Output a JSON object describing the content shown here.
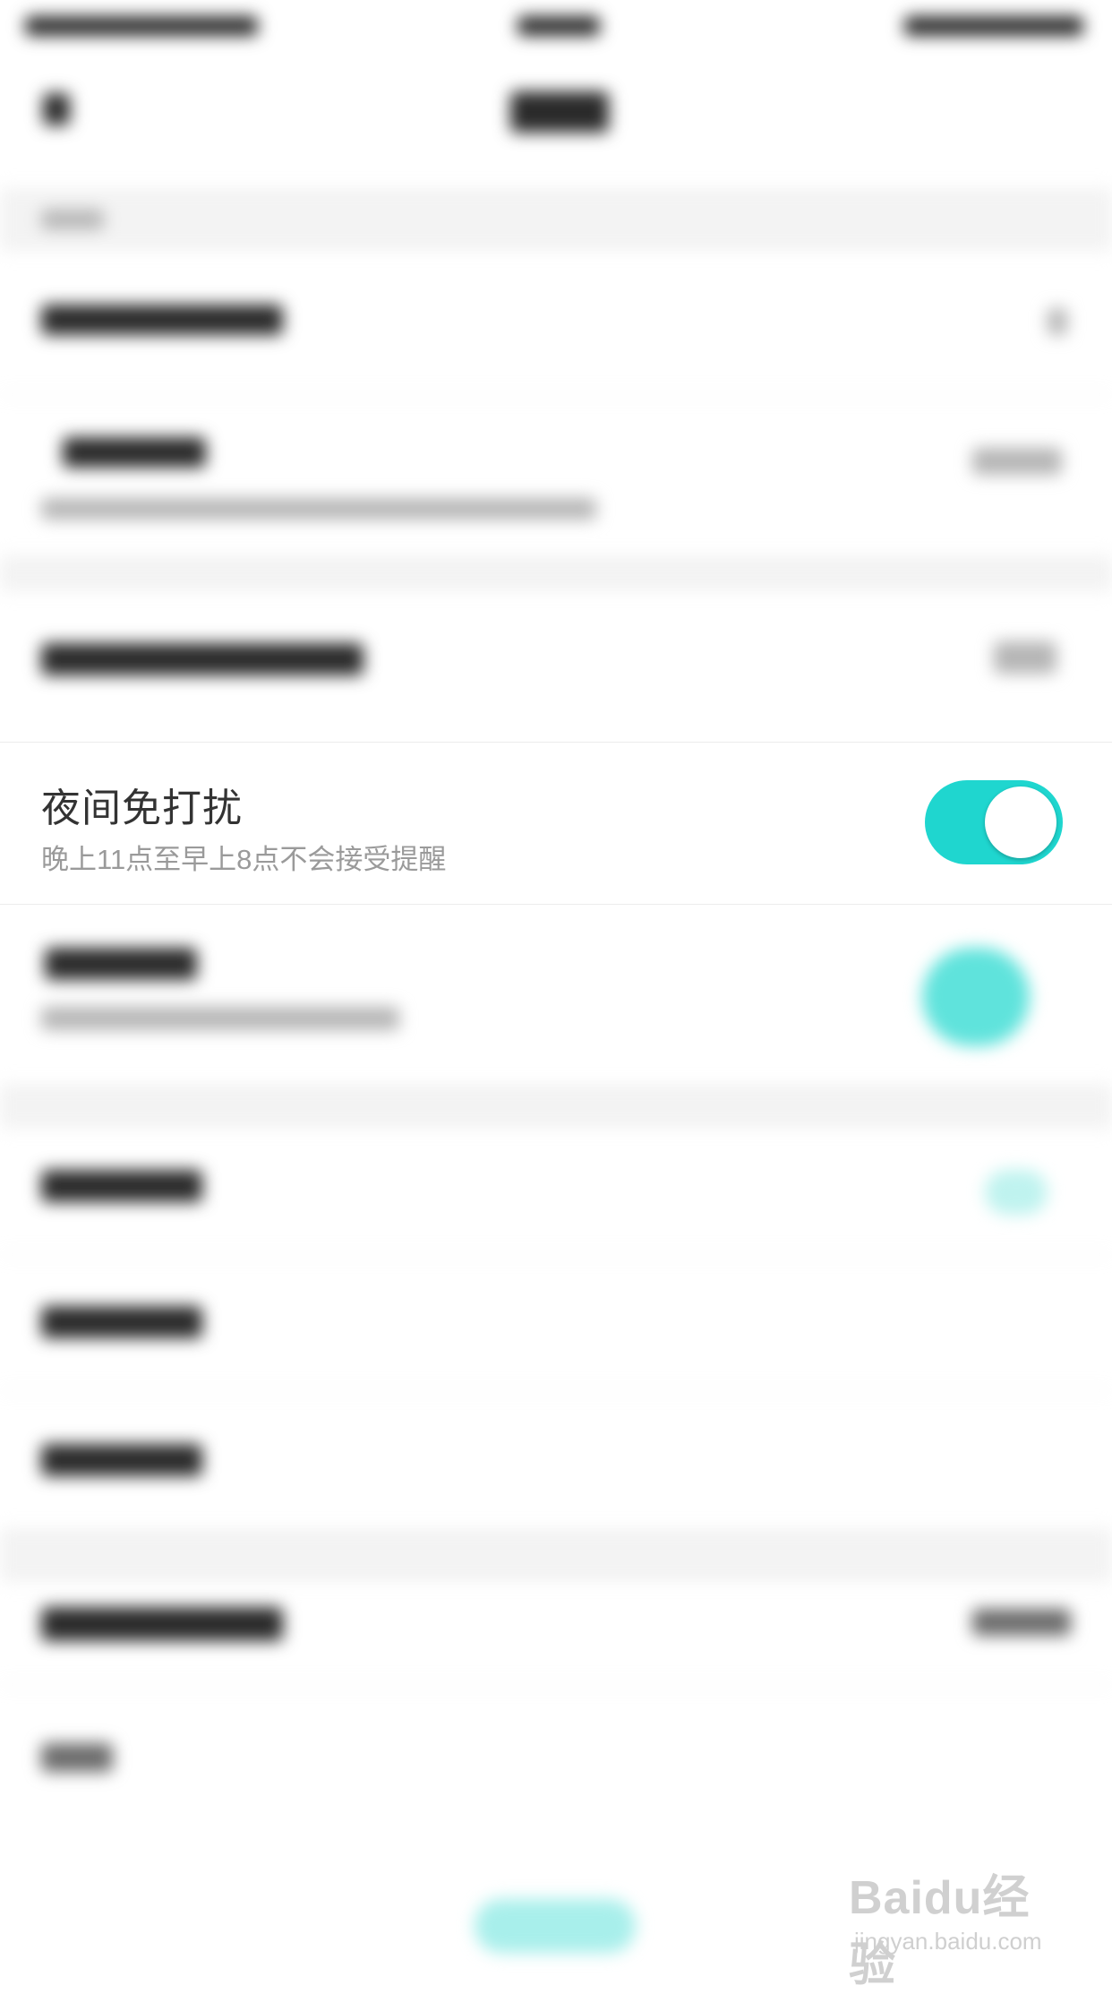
{
  "night_dnd": {
    "title": "夜间免打扰",
    "subtitle": "晚上11点至早上8点不会接受提醒",
    "enabled": true,
    "toggle_color": "#1fd6cf"
  },
  "watermark": {
    "logo_text": "Baidu经验",
    "url": "jingyan.baidu.com"
  }
}
